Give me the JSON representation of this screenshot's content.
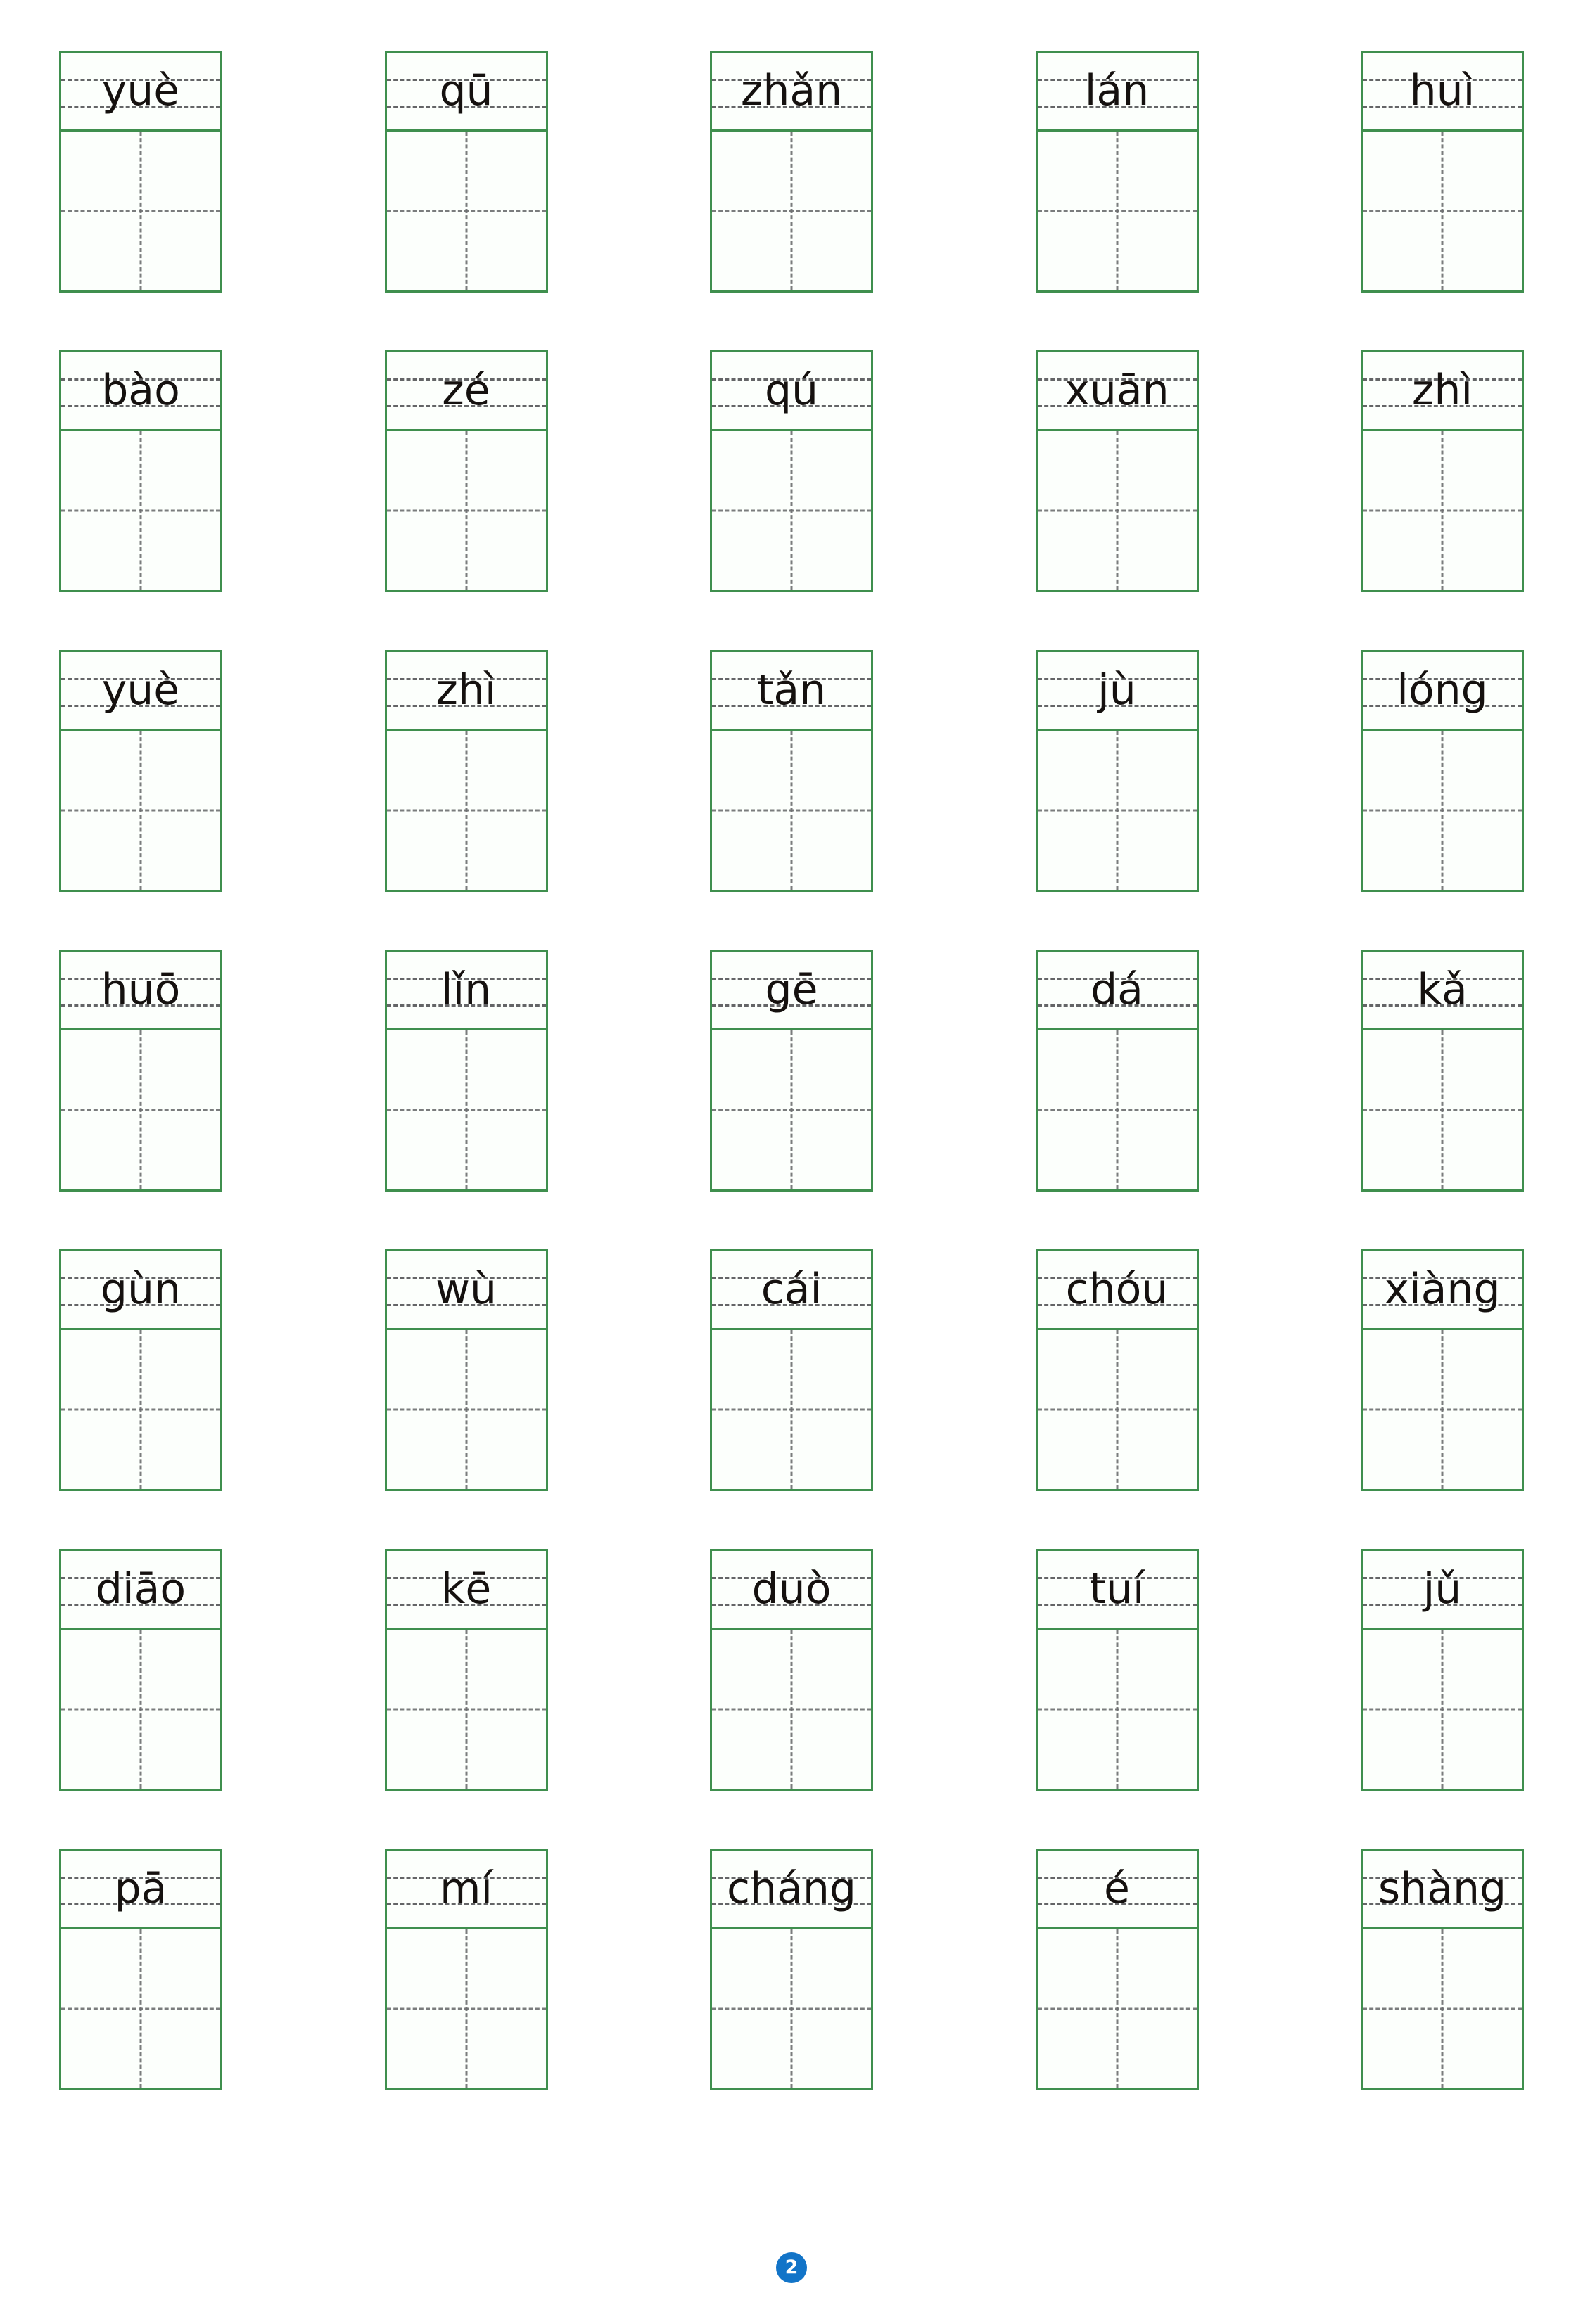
{
  "document": {
    "type": "pinyin-character-practice-worksheet",
    "page_number": "2"
  },
  "colors": {
    "cell_border": "#3f8f4e",
    "guide_line": "#58595b",
    "cross_line": "#6d6e70",
    "text": "#15110f",
    "page_badge_background": "#1274c8",
    "page_badge_text": "#ffffff",
    "cell_background": "#fcfffc",
    "page_background": "#ffffff"
  },
  "grid": {
    "columns": 5,
    "rows": 7,
    "rows_data": [
      {
        "cells": [
          {
            "pinyin": "yuè"
          },
          {
            "pinyin": "qū"
          },
          {
            "pinyin": "zhǎn"
          },
          {
            "pinyin": "lán"
          },
          {
            "pinyin": "huì"
          }
        ]
      },
      {
        "cells": [
          {
            "pinyin": "bào"
          },
          {
            "pinyin": "zé"
          },
          {
            "pinyin": "qú"
          },
          {
            "pinyin": "xuān"
          },
          {
            "pinyin": "zhì"
          }
        ]
      },
      {
        "cells": [
          {
            "pinyin": "yuè"
          },
          {
            "pinyin": "zhì"
          },
          {
            "pinyin": "tǎn"
          },
          {
            "pinyin": "jù"
          },
          {
            "pinyin": "lóng"
          }
        ]
      },
      {
        "cells": [
          {
            "pinyin": "huō"
          },
          {
            "pinyin": "lǐn"
          },
          {
            "pinyin": "gē"
          },
          {
            "pinyin": "dá"
          },
          {
            "pinyin": "kǎ"
          }
        ]
      },
      {
        "cells": [
          {
            "pinyin": "gùn"
          },
          {
            "pinyin": "wù"
          },
          {
            "pinyin": "cái"
          },
          {
            "pinyin": "chóu"
          },
          {
            "pinyin": "xiàng"
          }
        ]
      },
      {
        "cells": [
          {
            "pinyin": "diāo"
          },
          {
            "pinyin": "kē"
          },
          {
            "pinyin": "duò"
          },
          {
            "pinyin": "tuí"
          },
          {
            "pinyin": "jǔ"
          }
        ]
      },
      {
        "cells": [
          {
            "pinyin": "pā"
          },
          {
            "pinyin": "mí"
          },
          {
            "pinyin": "cháng"
          },
          {
            "pinyin": "é"
          },
          {
            "pinyin": "shàng"
          }
        ]
      }
    ]
  }
}
